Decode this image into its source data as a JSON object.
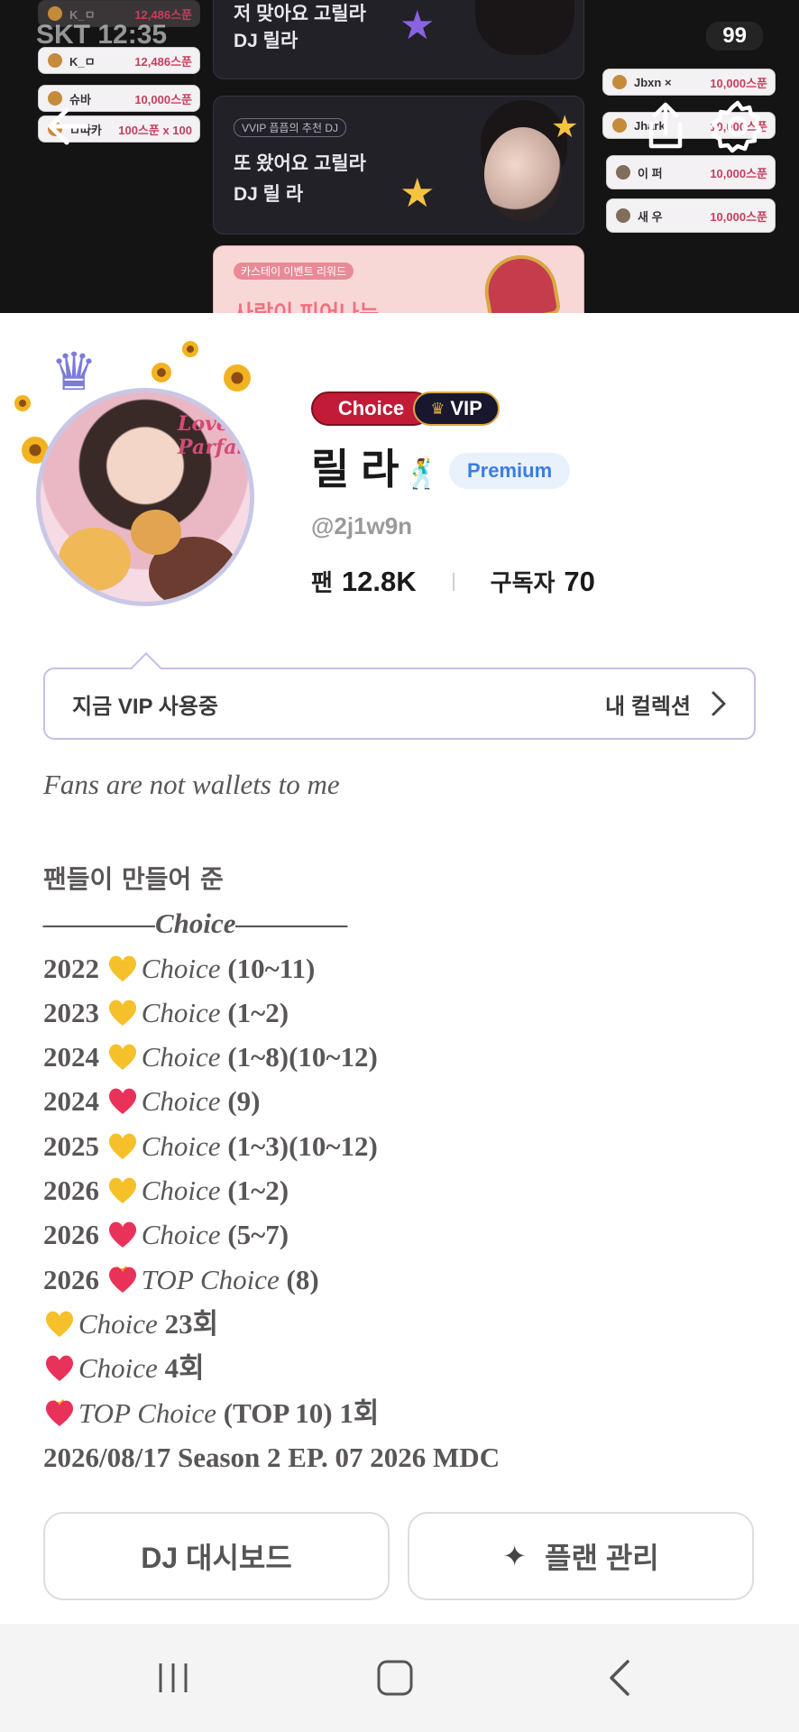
{
  "status": {
    "time": "12:35",
    "carrier": "SKT",
    "battery": "99"
  },
  "hero": {
    "chips_left": [
      {
        "name": "K_ㅁ",
        "amount": "12,486스푼"
      },
      {
        "name": "K_ㅁ",
        "amount": "12,486스푼"
      },
      {
        "name": "슈바",
        "amount": "10,000스푼"
      },
      {
        "name": "ㅁ따카",
        "amount": "100스푼 x 100"
      }
    ],
    "chips_right": [
      {
        "name": "Jbxn ×",
        "amount": "10,000스푼"
      },
      {
        "name": "Jhark",
        "amount": "10,000스푼"
      },
      {
        "name": "이 퍼",
        "amount": "10,000스푼"
      },
      {
        "name": "새 우",
        "amount": "10,000스푼"
      }
    ],
    "card1": {
      "line1": "저 맞아요 고릴라",
      "line2": "DJ 릴라"
    },
    "card2": {
      "tag": "VVIP 픕픕의 추천 DJ",
      "line1": "또 왔어요 고릴라",
      "line2": "DJ 릴 라"
    },
    "card3": {
      "tag": "카스테이 이벤트 리워드",
      "line1": "사랑이 피어나는"
    }
  },
  "profile": {
    "choice_badge": "Choice",
    "vip_badge": "VIP",
    "name": "릴 라",
    "name_emoji": "🕺",
    "premium_badge": "Premium",
    "handle": "@2j1w9n",
    "fans_label": "팬",
    "fans_value": "12.8K",
    "subs_label": "구독자",
    "subs_value": "70",
    "avatar_caption": "Love Parfait"
  },
  "vip_bar": {
    "left": "지금 VIP 사용중",
    "right": "내 컬렉션"
  },
  "bio": {
    "quote": "Fans are not wallets to me",
    "header": "팬들이 만들어 준",
    "divider": "————Choice————",
    "rows": [
      {
        "prefix": "2022 ",
        "heart": "yellow",
        "label": "Choice",
        "suffix": " (10~11)"
      },
      {
        "prefix": "2023 ",
        "heart": "yellow",
        "label": "Choice",
        "suffix": " (1~2)"
      },
      {
        "prefix": "2024 ",
        "heart": "yellow",
        "label": "Choice",
        "suffix": " (1~8)(10~12)"
      },
      {
        "prefix": "2024 ",
        "heart": "red",
        "label": "Choice",
        "suffix": " (9)"
      },
      {
        "prefix": "2025 ",
        "heart": "yellow",
        "label": "Choice",
        "suffix": " (1~3)(10~12)"
      },
      {
        "prefix": "2026 ",
        "heart": "yellow",
        "label": "Choice",
        "suffix": " (1~2)"
      },
      {
        "prefix": "2026 ",
        "heart": "red",
        "label": "Choice",
        "suffix": " (5~7)"
      },
      {
        "prefix": "2026 ",
        "heart": "fire",
        "label": "TOP Choice",
        "suffix": " (8)"
      },
      {
        "prefix": "",
        "heart": "yellow",
        "label": "Choice",
        "suffix": " 23회"
      },
      {
        "prefix": "",
        "heart": "red",
        "label": "Choice",
        "suffix": " 4회"
      },
      {
        "prefix": "",
        "heart": "fire",
        "label": "TOP Choice",
        "suffix": " (TOP 10) 1회"
      }
    ],
    "footer": "2026/08/17 Season 2 EP. 07 2026 MDC"
  },
  "buttons": {
    "dashboard": "DJ 대시보드",
    "plan": "플랜 관리"
  },
  "colors": {
    "choice_red": "#c21b37",
    "vip_navy": "#19172e",
    "premium_blue": "#3a7ee2",
    "heart_yellow": "#f5c02a",
    "heart_red": "#e8325a"
  }
}
